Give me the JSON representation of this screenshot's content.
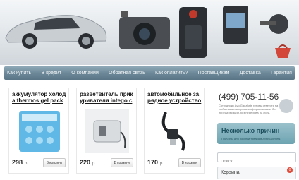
{
  "nav": {
    "items": [
      {
        "label": "Как купить"
      },
      {
        "label": "В кредит"
      },
      {
        "label": "О компании"
      },
      {
        "label": "Обратная связь"
      },
      {
        "label": "Как оплатить?"
      },
      {
        "label": "Поставщикам"
      },
      {
        "label": "Доставка"
      },
      {
        "label": "Гарантия"
      }
    ]
  },
  "products": [
    {
      "title_line1": "аккумулятор холод",
      "title_line2": "а thermos gel pack",
      "price": "298",
      "currency": "р.",
      "buy_label": "В корзину"
    },
    {
      "title_line1": "разветвитель прик",
      "title_line2": "уривателя intego c",
      "price": "220",
      "currency": "р.",
      "buy_label": "В корзину"
    },
    {
      "title_line1": "автомобильное за",
      "title_line2": "рядное устройство",
      "price": "170",
      "currency": "р.",
      "buy_label": "В корзину"
    }
  ],
  "sidebar": {
    "phone": "(499) 705-11-56",
    "phone_note": "Сотрудники AvtoGadzhets готовы ответить на любые ваши вопросы и оформить заказ без переадресации, без перерыва на обед.",
    "reasons_title": "Несколько причин",
    "reasons_sub": "Причины для покупки товара в AvtoGadzhets",
    "search_placeholder": "Поиск",
    "cart_label": "Корзина",
    "cart_count": "0"
  },
  "colors": {
    "nav": "#6d8898",
    "accent": "#e04a3a",
    "reasons": "#6da4b1"
  }
}
